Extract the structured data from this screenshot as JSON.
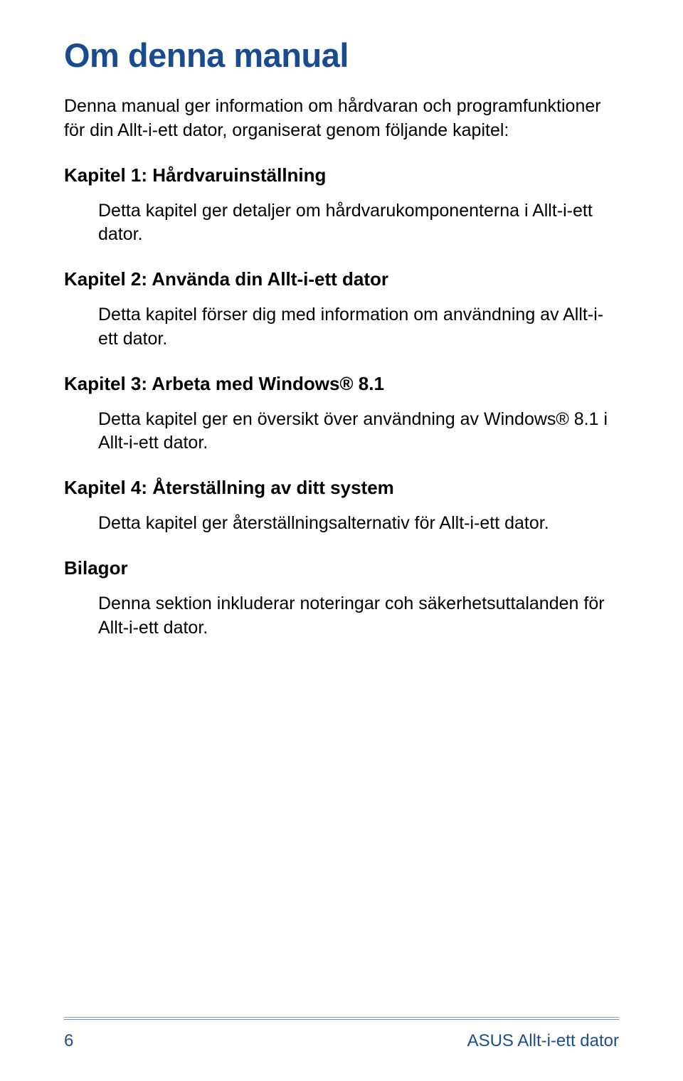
{
  "title": "Om denna manual",
  "intro": "Denna manual ger information om hårdvaran och programfunktioner för din Allt-i-ett dator, organiserat genom följande kapitel:",
  "sections": [
    {
      "heading": "Kapitel 1: Hårdvaruinställning",
      "body": "Detta kapitel ger detaljer om hårdvarukomponenterna i Allt-i-ett dator."
    },
    {
      "heading": "Kapitel 2: Använda din Allt-i-ett dator",
      "body": "Detta kapitel förser dig med information om användning av Allt-i-ett dator."
    },
    {
      "heading": "Kapitel 3: Arbeta med Windows® 8.1",
      "body": "Detta kapitel ger en översikt över användning av Windows® 8.1 i Allt-i-ett dator."
    },
    {
      "heading": "Kapitel 4: Återställning av ditt system",
      "body": "Detta kapitel ger återställningsalternativ för Allt-i-ett dator."
    },
    {
      "heading": "Bilagor",
      "body": "Denna sektion inkluderar noteringar coh säkerhetsuttalanden för Allt-i-ett dator."
    }
  ],
  "footer": {
    "page_number": "6",
    "brand": "ASUS Allt-i-ett dator"
  }
}
